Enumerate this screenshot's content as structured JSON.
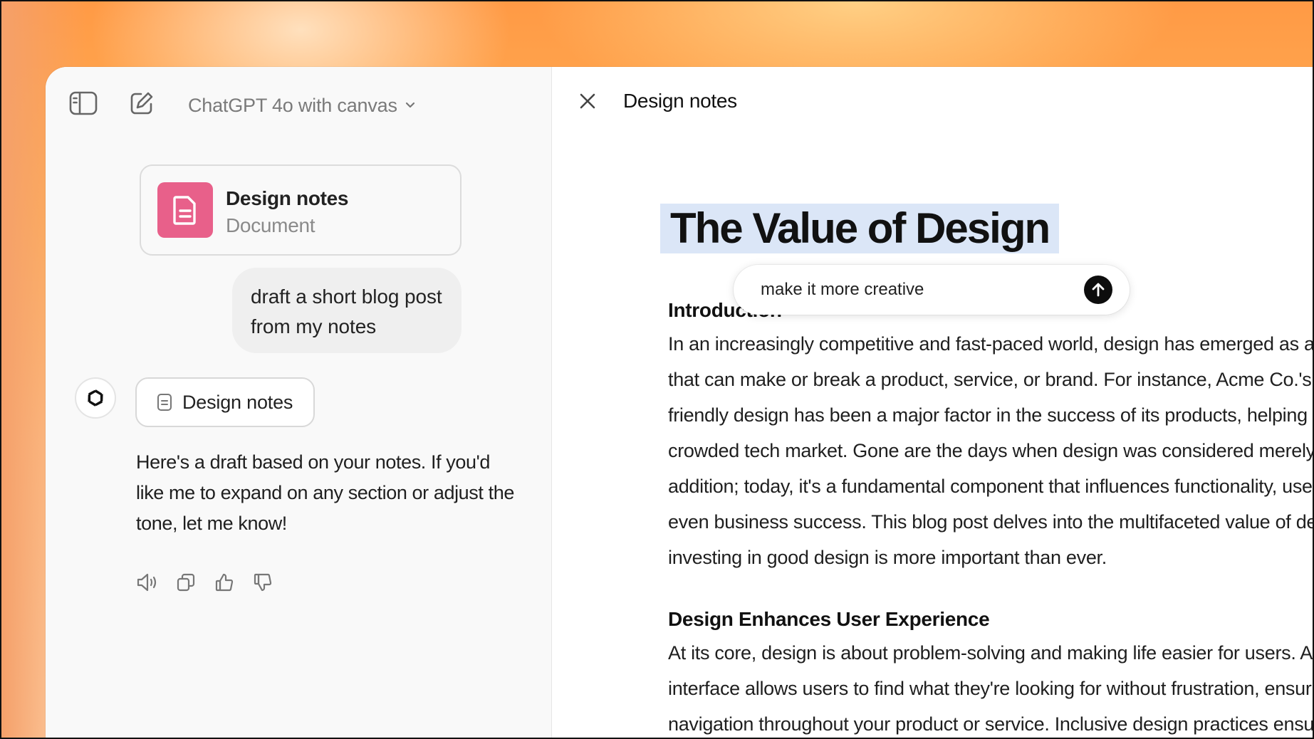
{
  "header": {
    "model_name": "ChatGPT 4o with canvas"
  },
  "chat": {
    "doc_card": {
      "title": "Design notes",
      "subtitle": "Document"
    },
    "user_message": "draft a short blog post from my notes",
    "doc_chip_label": "Design notes",
    "assistant_message": "Here's a draft based on your notes. If you'd like me to expand on any section or adjust the tone, let me know!",
    "action_icons": [
      "speaker-icon",
      "copy-icon",
      "thumbs-up-icon",
      "thumbs-down-icon"
    ]
  },
  "canvas": {
    "doc_title": "Design notes",
    "heading": "The Value of Design",
    "inline_prompt": {
      "value": "make it more creative"
    },
    "sections": [
      {
        "title": "Introduction",
        "lines": [
          "In an increasingly competitive and fast-paced world, design has emerged as a critical",
          "that can make or break a product, service, or brand. For instance, Acme Co.'s focus on",
          "friendly design has been a major factor in the success of its products, helping it stand out",
          "crowded tech market. Gone are the days when design was considered merely an aesthetic",
          "addition; today, it's a fundamental component that influences functionality, user experience,",
          "even business success. This blog post delves into the multifaceted value of design and",
          "investing in good design is more important than ever."
        ]
      },
      {
        "title": "Design Enhances User Experience",
        "lines": [
          "At its core, design is about problem-solving and making life easier for users. A well-designed",
          "interface allows users to find what they're looking for without frustration, ensuring intuitive",
          "navigation throughout your product or service. Inclusive design practices ensure that"
        ]
      }
    ]
  },
  "colors": {
    "doc_badge": "#e8608a",
    "heading_highlight": "#dbe6f7",
    "send_button": "#0d0d0d"
  }
}
